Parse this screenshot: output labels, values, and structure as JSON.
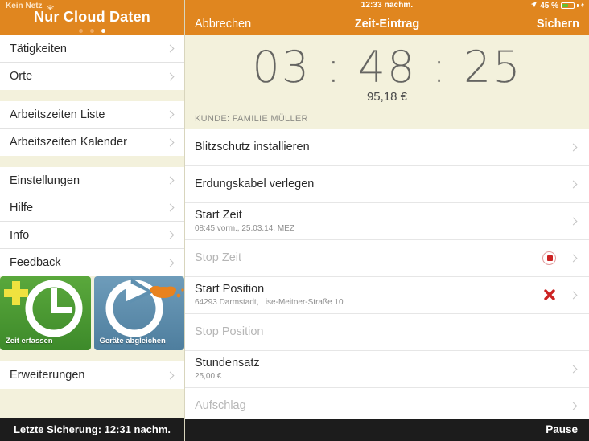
{
  "sidebar": {
    "status": {
      "carrier": "Kein Netz",
      "wifi_icon": "wifi-icon"
    },
    "title": "Nur Cloud Daten",
    "page_dots": {
      "count": 3,
      "active_index": 2
    },
    "groups": [
      {
        "items": [
          {
            "label": "Tätigkeiten"
          },
          {
            "label": "Orte"
          }
        ]
      },
      {
        "items": [
          {
            "label": "Arbeitszeiten Liste"
          },
          {
            "label": "Arbeitszeiten Kalender"
          }
        ]
      },
      {
        "items": [
          {
            "label": "Einstellungen"
          },
          {
            "label": "Hilfe"
          },
          {
            "label": "Info"
          },
          {
            "label": "Feedback"
          }
        ]
      }
    ],
    "tiles": [
      {
        "label": "Zeit erfassen",
        "icon": "clock-plus-icon",
        "color": "#4e9c34"
      },
      {
        "label": "Geräte abgleichen",
        "icon": "sync-cloud-icon",
        "color": "#5f90b0"
      }
    ],
    "extensions": {
      "label": "Erweiterungen"
    },
    "footer": {
      "label": "Letzte Sicherung: 12:31 nachm."
    }
  },
  "detail": {
    "statusbar": {
      "clock": "12:33 nachm.",
      "battery_percent": "45 %",
      "battery_level": 45,
      "location_icon": "location-arrow-icon",
      "battery_icon": "battery-charging-icon"
    },
    "navbar": {
      "cancel": "Abbrechen",
      "title": "Zeit-Eintrag",
      "save": "Sichern"
    },
    "hero": {
      "timer": "03 : 48 : 25",
      "amount": "95,18 €",
      "customer": "KUNDE: FAMILIE MÜLLER"
    },
    "rows": [
      {
        "title": "Blitzschutz installieren",
        "sub": "",
        "dim": false,
        "accessory": ""
      },
      {
        "title": "Erdungskabel verlegen",
        "sub": "",
        "dim": false,
        "accessory": ""
      },
      {
        "title": "Start Zeit",
        "sub": "08:45 vorm., 25.03.14, MEZ",
        "dim": false,
        "accessory": ""
      },
      {
        "title": "Stop Zeit",
        "sub": "",
        "dim": true,
        "accessory": "stop-record-icon"
      },
      {
        "title": "Start Position",
        "sub": "64293 Darmstadt, Lise-Meitner-Straße 10",
        "dim": false,
        "accessory": "red-x-icon"
      },
      {
        "title": "Stop Position",
        "sub": "",
        "dim": true,
        "accessory": ""
      },
      {
        "title": "Stundensatz",
        "sub": "25,00 €",
        "dim": false,
        "accessory": ""
      },
      {
        "title": "Aufschlag",
        "sub": "",
        "dim": true,
        "accessory": ""
      }
    ],
    "footer": {
      "pause": "Pause"
    }
  },
  "colors": {
    "accent": "#e0861f",
    "cream": "#f3f1dc",
    "bar": "#1c1c1c",
    "danger": "#cc2222",
    "battery": "#63c132"
  }
}
